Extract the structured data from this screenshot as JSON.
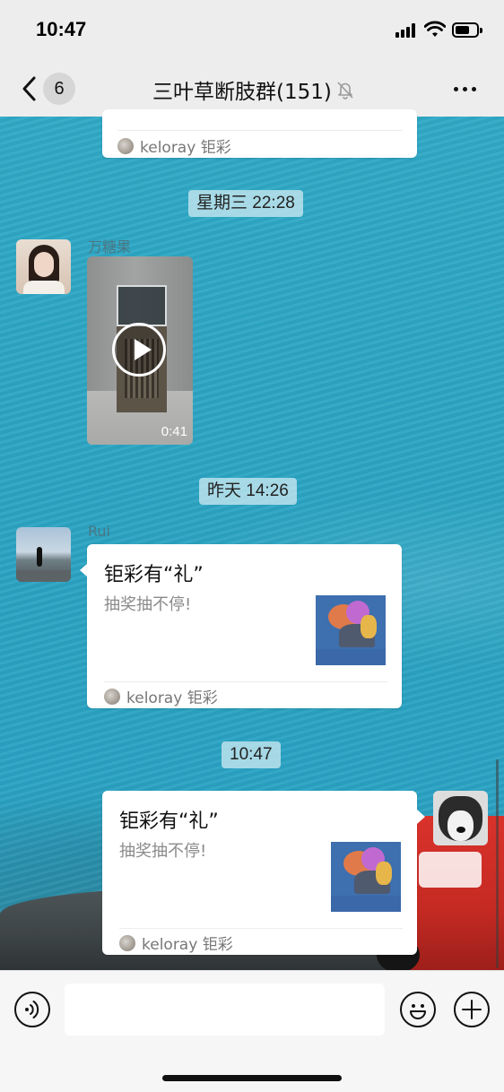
{
  "status_bar": {
    "time": "10:47",
    "icons": [
      "cellular-signal-icon",
      "wifi-icon",
      "battery-icon"
    ]
  },
  "header": {
    "back_icon": "chevron-left-icon",
    "unread_count": "6",
    "title": "三叶草断肢群(151)",
    "mute_icon": "bell-slash-icon",
    "more_icon": "ellipsis-icon"
  },
  "messages": {
    "top_card": {
      "source": "keloray 钜彩"
    },
    "ts_wed": "星期三 22:28",
    "video_msg": {
      "sender": "万糖果",
      "duration": "0:41",
      "play_icon": "play-icon"
    },
    "ts_yesterday": "昨天 14:26",
    "rui_card": {
      "sender": "Rui",
      "title": "钜彩有“礼”",
      "desc": "抽奖抽不停!",
      "source": "keloray 钜彩"
    },
    "ts_now": "10:47",
    "my_card": {
      "title": "钜彩有“礼”",
      "desc": "抽奖抽不停!",
      "source": "keloray 钜彩"
    }
  },
  "input_bar": {
    "voice_icon": "voice-icon",
    "text_value": "",
    "emoji_icon": "emoji-icon",
    "plus_icon": "plus-icon"
  },
  "colors": {
    "chat_background": "#2ea6c4",
    "header_background": "#ededed",
    "timestamp_background": "#c8e8f0",
    "card_background": "#ffffff",
    "input_bar_background": "#f6f6f6"
  }
}
